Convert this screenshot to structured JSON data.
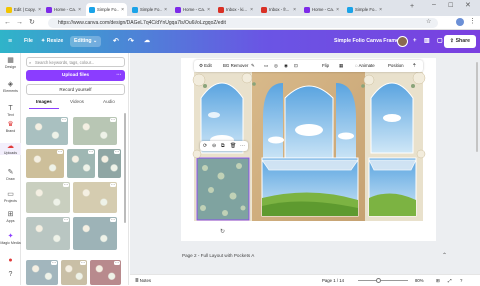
{
  "tabs": [
    {
      "label": "Edit | Copy...",
      "color": "#f2c400"
    },
    {
      "label": "Home - Ca...",
      "color": "#7d2ae8"
    },
    {
      "label": "Simple Fo...",
      "color": "#1aa3e8"
    },
    {
      "label": "Simple Fo...",
      "color": "#1aa3e8"
    },
    {
      "label": "Home - Ca...",
      "color": "#7d2ae8"
    },
    {
      "label": "Inbox - ki...",
      "color": "#d93025"
    },
    {
      "label": "Inbox - fr...",
      "color": "#d93025"
    },
    {
      "label": "Home - Ca...",
      "color": "#7d2ae8"
    },
    {
      "label": "Simple Fo...",
      "color": "#1aa3e8"
    }
  ],
  "address": {
    "url": "https://www.canva.com/design/DAGeL7q4C/dYnUgqa7ls/Ou6i/oLzgqoZ/edit"
  },
  "header": {
    "file": "File",
    "resize": "✦ Resize",
    "editing": "Editing",
    "title": "Simple Folio Canva Frames",
    "share": "Share"
  },
  "rail": [
    "Design",
    "Elements",
    "Text",
    "Brand",
    "Uploads",
    "Draw",
    "Projects",
    "Apps",
    "Magic Media"
  ],
  "panel": {
    "search_placeholder": "Search keywords, tags, colour...",
    "upload": "Upload files",
    "record": "Record yourself",
    "tabs": [
      "Images",
      "Videos",
      "Audio"
    ]
  },
  "toolbar": {
    "edit": "Edit",
    "bg_remover": "BG Remover",
    "flip": "Flip",
    "animate": "Animate",
    "position": "Position"
  },
  "page_label": "Page 2 - Full Layout with Pockets A",
  "footer": {
    "notes": "Notes",
    "pages": "Page 1 / 14",
    "zoom": "80%"
  }
}
